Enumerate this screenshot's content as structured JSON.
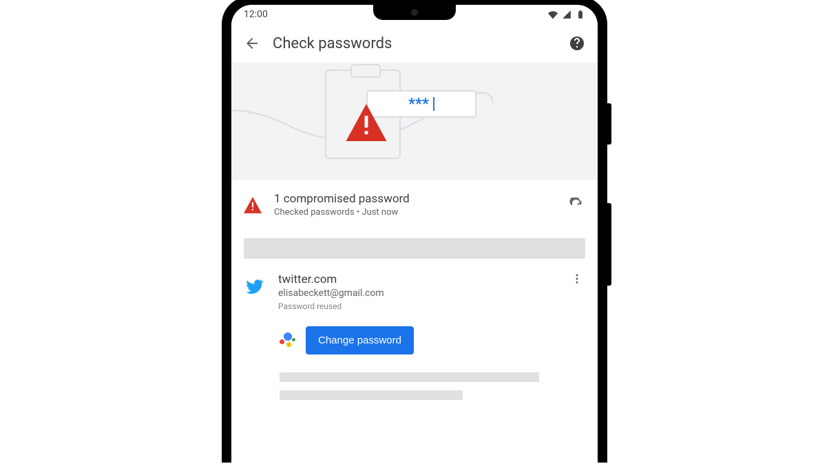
{
  "status_bar": {
    "time": "12:00"
  },
  "app_bar": {
    "title": "Check passwords"
  },
  "hero": {
    "password_mask": "***"
  },
  "summary": {
    "title": "1 compromised password",
    "subtitle": "Checked passwords • Just now"
  },
  "compromised": {
    "site": "twitter.com",
    "username": "elisabeckett@gmail.com",
    "note": "Password reused",
    "action_label": "Change password"
  }
}
